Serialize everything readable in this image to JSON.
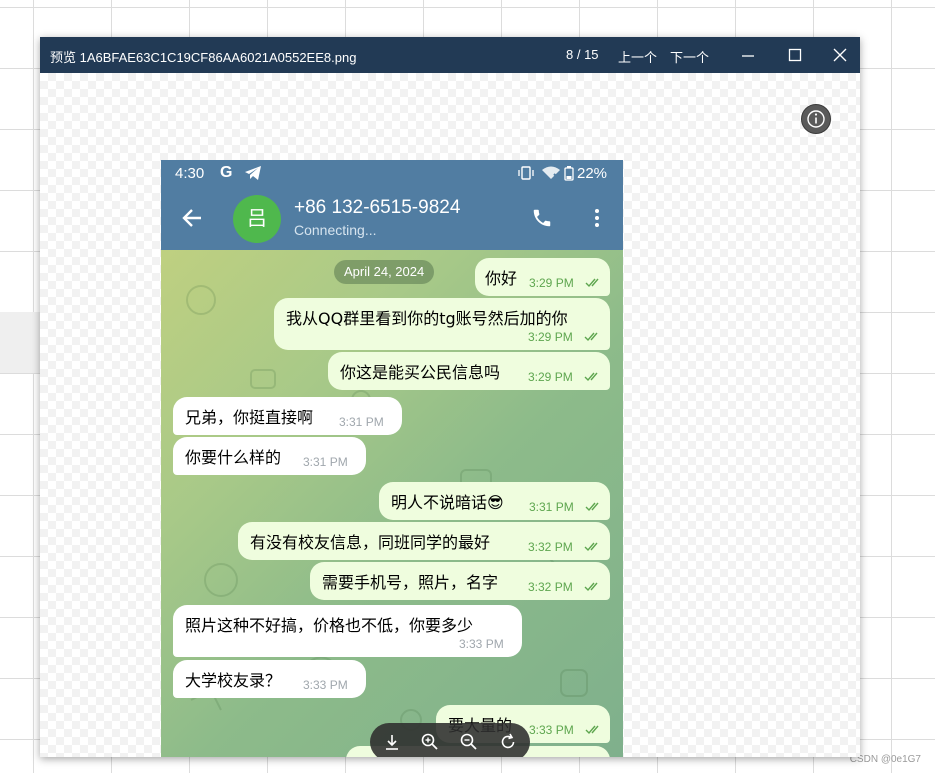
{
  "window": {
    "title": "预览 1A6BFAE63C1C19CF86AA6021A0552EE8.png",
    "counter": "8 / 15",
    "prev_label": "上一个",
    "next_label": "下一个"
  },
  "phone": {
    "status": {
      "time": "4:30",
      "g_icon_text": "G",
      "battery_pct": "22%"
    },
    "contact": {
      "avatar_text": "吕",
      "avatar_color": "#4fb84d",
      "name": "+86 132-6515-9824",
      "status": "Connecting..."
    },
    "date_chip": "April 24, 2024",
    "messages": [
      {
        "dir": "out",
        "text": "你好",
        "time": "3:29 PM"
      },
      {
        "dir": "out",
        "text": "我从QQ群里看到你的tg账号然后加的你",
        "time": "3:29 PM"
      },
      {
        "dir": "out",
        "text": "你这是能买公民信息吗",
        "time": "3:29 PM"
      },
      {
        "dir": "in",
        "text": "兄弟，你挺直接啊",
        "time": "3:31 PM"
      },
      {
        "dir": "in",
        "text": "你要什么样的",
        "time": "3:31 PM"
      },
      {
        "dir": "out",
        "text": "明人不说暗话😎",
        "time": "3:31 PM"
      },
      {
        "dir": "out",
        "text": "有没有校友信息，同班同学的最好",
        "time": "3:32 PM"
      },
      {
        "dir": "out",
        "text": "需要手机号，照片，名字",
        "time": "3:32 PM"
      },
      {
        "dir": "in",
        "text": "照片这种不好搞，价格也不低，你要多少",
        "time": "3:33 PM"
      },
      {
        "dir": "in",
        "text": "大学校友录？",
        "time": "3:33 PM"
      },
      {
        "dir": "out",
        "text": "要大量的",
        "time": "3:33 PM"
      }
    ],
    "colors": {
      "header": "#517da2",
      "out_bubble": "#effdde",
      "in_bubble": "#ffffff",
      "tick": "#5ea64f"
    }
  },
  "toolbar": {
    "icons": [
      "download-icon",
      "zoom-in-icon",
      "zoom-out-icon",
      "rotate-icon"
    ]
  },
  "watermark": "CSDN @0e1G7"
}
